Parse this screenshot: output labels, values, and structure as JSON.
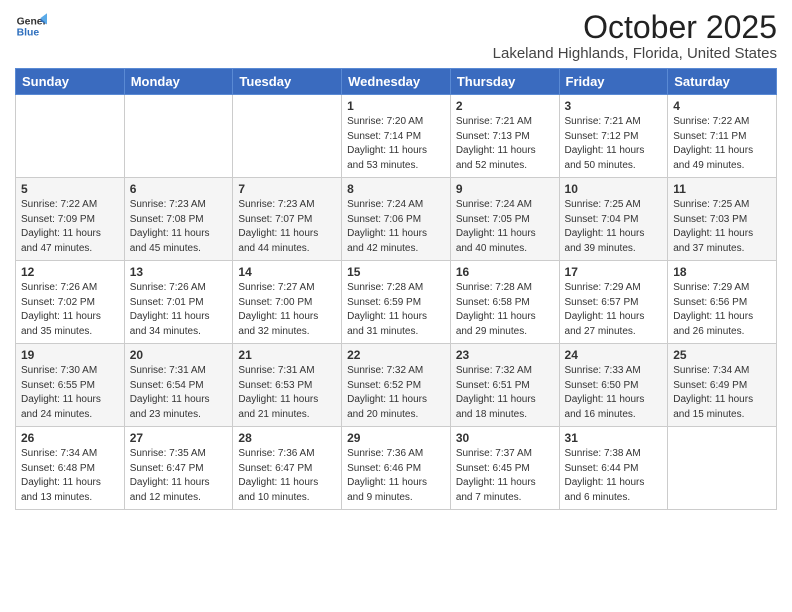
{
  "logo": {
    "line1": "General",
    "line2": "Blue"
  },
  "title": "October 2025",
  "location": "Lakeland Highlands, Florida, United States",
  "days_of_week": [
    "Sunday",
    "Monday",
    "Tuesday",
    "Wednesday",
    "Thursday",
    "Friday",
    "Saturday"
  ],
  "weeks": [
    [
      {
        "day": "",
        "info": ""
      },
      {
        "day": "",
        "info": ""
      },
      {
        "day": "",
        "info": ""
      },
      {
        "day": "1",
        "info": "Sunrise: 7:20 AM\nSunset: 7:14 PM\nDaylight: 11 hours\nand 53 minutes."
      },
      {
        "day": "2",
        "info": "Sunrise: 7:21 AM\nSunset: 7:13 PM\nDaylight: 11 hours\nand 52 minutes."
      },
      {
        "day": "3",
        "info": "Sunrise: 7:21 AM\nSunset: 7:12 PM\nDaylight: 11 hours\nand 50 minutes."
      },
      {
        "day": "4",
        "info": "Sunrise: 7:22 AM\nSunset: 7:11 PM\nDaylight: 11 hours\nand 49 minutes."
      }
    ],
    [
      {
        "day": "5",
        "info": "Sunrise: 7:22 AM\nSunset: 7:09 PM\nDaylight: 11 hours\nand 47 minutes."
      },
      {
        "day": "6",
        "info": "Sunrise: 7:23 AM\nSunset: 7:08 PM\nDaylight: 11 hours\nand 45 minutes."
      },
      {
        "day": "7",
        "info": "Sunrise: 7:23 AM\nSunset: 7:07 PM\nDaylight: 11 hours\nand 44 minutes."
      },
      {
        "day": "8",
        "info": "Sunrise: 7:24 AM\nSunset: 7:06 PM\nDaylight: 11 hours\nand 42 minutes."
      },
      {
        "day": "9",
        "info": "Sunrise: 7:24 AM\nSunset: 7:05 PM\nDaylight: 11 hours\nand 40 minutes."
      },
      {
        "day": "10",
        "info": "Sunrise: 7:25 AM\nSunset: 7:04 PM\nDaylight: 11 hours\nand 39 minutes."
      },
      {
        "day": "11",
        "info": "Sunrise: 7:25 AM\nSunset: 7:03 PM\nDaylight: 11 hours\nand 37 minutes."
      }
    ],
    [
      {
        "day": "12",
        "info": "Sunrise: 7:26 AM\nSunset: 7:02 PM\nDaylight: 11 hours\nand 35 minutes."
      },
      {
        "day": "13",
        "info": "Sunrise: 7:26 AM\nSunset: 7:01 PM\nDaylight: 11 hours\nand 34 minutes."
      },
      {
        "day": "14",
        "info": "Sunrise: 7:27 AM\nSunset: 7:00 PM\nDaylight: 11 hours\nand 32 minutes."
      },
      {
        "day": "15",
        "info": "Sunrise: 7:28 AM\nSunset: 6:59 PM\nDaylight: 11 hours\nand 31 minutes."
      },
      {
        "day": "16",
        "info": "Sunrise: 7:28 AM\nSunset: 6:58 PM\nDaylight: 11 hours\nand 29 minutes."
      },
      {
        "day": "17",
        "info": "Sunrise: 7:29 AM\nSunset: 6:57 PM\nDaylight: 11 hours\nand 27 minutes."
      },
      {
        "day": "18",
        "info": "Sunrise: 7:29 AM\nSunset: 6:56 PM\nDaylight: 11 hours\nand 26 minutes."
      }
    ],
    [
      {
        "day": "19",
        "info": "Sunrise: 7:30 AM\nSunset: 6:55 PM\nDaylight: 11 hours\nand 24 minutes."
      },
      {
        "day": "20",
        "info": "Sunrise: 7:31 AM\nSunset: 6:54 PM\nDaylight: 11 hours\nand 23 minutes."
      },
      {
        "day": "21",
        "info": "Sunrise: 7:31 AM\nSunset: 6:53 PM\nDaylight: 11 hours\nand 21 minutes."
      },
      {
        "day": "22",
        "info": "Sunrise: 7:32 AM\nSunset: 6:52 PM\nDaylight: 11 hours\nand 20 minutes."
      },
      {
        "day": "23",
        "info": "Sunrise: 7:32 AM\nSunset: 6:51 PM\nDaylight: 11 hours\nand 18 minutes."
      },
      {
        "day": "24",
        "info": "Sunrise: 7:33 AM\nSunset: 6:50 PM\nDaylight: 11 hours\nand 16 minutes."
      },
      {
        "day": "25",
        "info": "Sunrise: 7:34 AM\nSunset: 6:49 PM\nDaylight: 11 hours\nand 15 minutes."
      }
    ],
    [
      {
        "day": "26",
        "info": "Sunrise: 7:34 AM\nSunset: 6:48 PM\nDaylight: 11 hours\nand 13 minutes."
      },
      {
        "day": "27",
        "info": "Sunrise: 7:35 AM\nSunset: 6:47 PM\nDaylight: 11 hours\nand 12 minutes."
      },
      {
        "day": "28",
        "info": "Sunrise: 7:36 AM\nSunset: 6:47 PM\nDaylight: 11 hours\nand 10 minutes."
      },
      {
        "day": "29",
        "info": "Sunrise: 7:36 AM\nSunset: 6:46 PM\nDaylight: 11 hours\nand 9 minutes."
      },
      {
        "day": "30",
        "info": "Sunrise: 7:37 AM\nSunset: 6:45 PM\nDaylight: 11 hours\nand 7 minutes."
      },
      {
        "day": "31",
        "info": "Sunrise: 7:38 AM\nSunset: 6:44 PM\nDaylight: 11 hours\nand 6 minutes."
      },
      {
        "day": "",
        "info": ""
      }
    ]
  ]
}
